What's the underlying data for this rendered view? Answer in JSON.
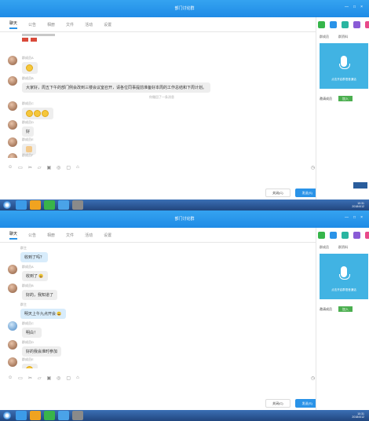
{
  "app": {
    "title": "部门讨论群",
    "window_controls": [
      "—",
      "□",
      "×"
    ]
  },
  "tabs": [
    "聊天",
    "公告",
    "相册",
    "文件",
    "活动",
    "设置"
  ],
  "right_panel": {
    "tabs": [
      "群成员",
      "群资料"
    ],
    "voice_hint": "点击开启群语音通话",
    "btn_left": "邀请成员",
    "btn_right": "加入"
  },
  "shot1": {
    "messages": [
      {
        "nick": "群成员A",
        "content": "😀"
      },
      {
        "nick": "群成员B",
        "content": "大家好，周五下午的部门例会改到三楼会议室召开，请各位同事提前准备好本周的工作总结和下周计划。"
      },
      {
        "nick": "群成员C",
        "content": "😀😀😀"
      },
      {
        "nick": "群成员D",
        "content": "好"
      },
      {
        "nick": "群成员E",
        "content": "👍"
      },
      {
        "nick": "群成员F",
        "content": ""
      }
    ],
    "recall_notice": "你撤回了一条消息"
  },
  "shot2": {
    "messages": [
      {
        "nick": "群主",
        "content": "收到了吗？",
        "style": "blue"
      },
      {
        "nick": "群成员A",
        "content": "收到了 😀"
      },
      {
        "nick": "群成员B",
        "content": "好的，我知道了"
      },
      {
        "nick": "群主",
        "content": "明天上午九点开会 😀",
        "style": "blue"
      },
      {
        "nick": "群成员C",
        "content": "明白！"
      },
      {
        "nick": "群成员D",
        "content": "好的我会准时参加"
      },
      {
        "nick": "群成员E",
        "content": "😀"
      }
    ]
  },
  "composer": {
    "btn_close": "关闭(C)",
    "btn_send": "发送(S)"
  },
  "tray": {
    "time": "10:31",
    "date": "2018/4/12"
  },
  "colors": {
    "accent": "#2a93e8",
    "voice_panel": "#41b3e3",
    "join_button": "#4caf50"
  }
}
